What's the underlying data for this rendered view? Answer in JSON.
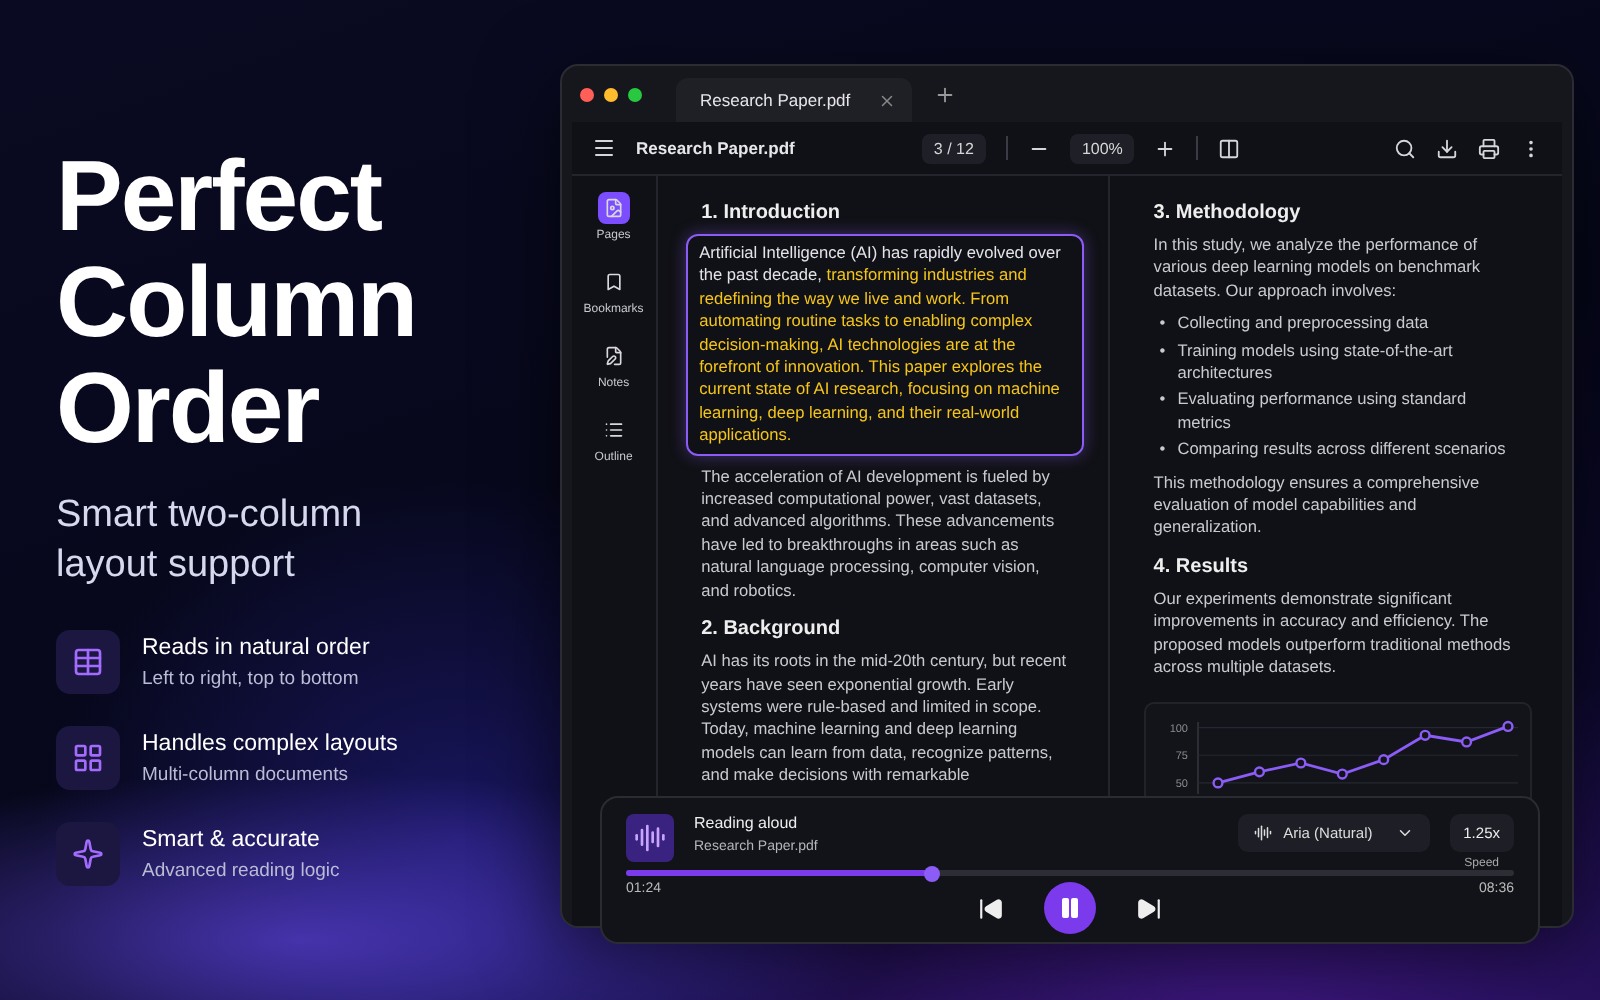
{
  "hero": {
    "title": "Perfect Column Order",
    "subtitle": "Smart two-column layout support",
    "features": [
      {
        "kind": "table",
        "title": "Reads in natural order",
        "subtitle": "Left to right, top to bottom"
      },
      {
        "kind": "grid",
        "title": "Handles complex layouts",
        "subtitle": "Multi-column documents"
      },
      {
        "kind": "sparkle",
        "title": "Smart & accurate",
        "subtitle": "Advanced reading logic"
      }
    ]
  },
  "window": {
    "tabs": [
      {
        "label": "Research Paper.pdf",
        "selected": true
      }
    ],
    "toolbar": {
      "file_name": "Research Paper.pdf",
      "page_current": "3",
      "page_total": "/ 12",
      "zoom": "100%"
    },
    "sidebar": [
      {
        "kind": "pages",
        "label": "Pages",
        "selected": true
      },
      {
        "kind": "bookmarks",
        "label": "Bookmarks",
        "selected": false
      },
      {
        "kind": "notes",
        "label": "Notes",
        "selected": false
      },
      {
        "kind": "outline",
        "label": "Outline",
        "selected": false
      }
    ],
    "columns": [
      [
        {
          "kind": "heading",
          "text": "1.  Introduction"
        },
        {
          "kind": "highlight",
          "segments": [
            {
              "text": "Artificial Intelligence (AI) has rapidly evolved over the past decade, ",
              "highlighted": false
            },
            {
              "text": "transforming industries and redefining the way we live and work. From automating routine tasks to enabling complex decision-making, AI technologies are at the forefront of innovation. This paper explores the current state of AI research, focusing on machine learning, deep learning, and their real-world applications.",
              "highlighted": true
            }
          ]
        },
        {
          "kind": "paragraph",
          "text": "The acceleration of AI development is fueled by increased computational power, vast datasets, and advanced algorithms. These advancements have led to breakthroughs in areas such as natural language processing, computer vision, and robotics."
        },
        {
          "kind": "heading",
          "text": "2.  Background"
        },
        {
          "kind": "paragraph",
          "text": "AI has its roots in the mid-20th century, but recent years have seen exponential growth. Early systems were rule-based and limited in scope. Today, machine learning and deep learning models can learn from data, recognize patterns, and make decisions with remarkable"
        }
      ],
      [
        {
          "kind": "heading",
          "text": "3. Methodology"
        },
        {
          "kind": "paragraph",
          "text": "In this study, we analyze the performance of various deep learning models on benchmark datasets. Our approach involves:"
        },
        {
          "kind": "list",
          "marker": "•",
          "items": [
            "Collecting and preprocessing data",
            "Training models using state-of-the-art architectures",
            "Evaluating performance using standard metrics",
            "Comparing results across different scenarios"
          ]
        },
        {
          "kind": "paragraph",
          "text": "This methodology ensures a comprehensive evaluation of model capabilities and generalization."
        },
        {
          "kind": "heading",
          "text": "4. Results"
        },
        {
          "kind": "paragraph",
          "text": "Our experiments demonstrate significant improvements in accuracy and efficiency. The proposed models outperform traditional methods across multiple datasets."
        },
        {
          "kind": "chart",
          "chart_data": {
            "type": "line",
            "series": [
              {
                "color": "#8b5cf6",
                "marker": "circle",
                "values": [
                  50,
                  60,
                  68,
                  58,
                  71,
                  93,
                  87,
                  101
                ]
              }
            ],
            "ylim": [
              40,
              105
            ],
            "grid": true,
            "yticks": [
              50,
              75,
              100
            ]
          }
        }
      ]
    ]
  },
  "player": {
    "title": "Reading aloud",
    "file": "Research Paper.pdf",
    "voice": "Aria (Natural)",
    "speed": "1.25x",
    "speed_label": "Speed",
    "level": 0.345,
    "elapsed": "01:24",
    "duration": "08:36",
    "playing": true
  }
}
